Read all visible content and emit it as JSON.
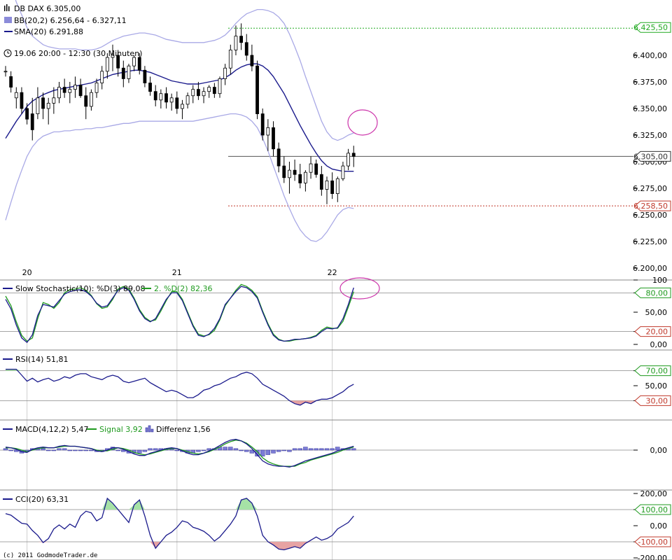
{
  "colors": {
    "navy": "#1a1a8c",
    "band": "#a9a9e6",
    "green": "#1f9a1f",
    "pinkFill": "#e7a3a3",
    "greenFill": "#a6e2a6",
    "histo": "#7c7cd6",
    "red": "#c0392b",
    "magenta": "#cc33aa",
    "grid": "#999999"
  },
  "legend": {
    "symbol": "DB DAX 6.305,00",
    "bb": "BB(20,2) 6.256,64 - 6.327,11",
    "sma": "SMA(20) 6.291,88",
    "time": "19.06 20:00 - 12:30 (30 Minuten)"
  },
  "price_badges": {
    "top": "6.425,50",
    "last": "6.305,00",
    "low": "6.258,50"
  },
  "x_labels": [
    "20",
    "21",
    "22"
  ],
  "copyright": "(c) 2011 GodmodeTrader.de",
  "panels": {
    "stoch": {
      "legend1": "Slow Stochastic(10): %D(3) 89,08",
      "legend2": "2. %D(2) 82,36",
      "ticks": [
        "100",
        "80,00",
        "50,00",
        "20,00",
        "0,00"
      ],
      "tickVals": [
        100,
        80,
        50,
        20,
        0
      ],
      "badges": [
        "80,00",
        "20,00"
      ]
    },
    "rsi": {
      "legend": "RSI(14) 51,81",
      "ticks": [
        "70,00",
        "50,00",
        "30,00"
      ],
      "tickVals": [
        70,
        50,
        30
      ],
      "badges": [
        "70,00",
        "30,00"
      ]
    },
    "macd": {
      "legend1": "MACD(4,12,2) 5,47",
      "legend2": "Signal 3,92",
      "legend3": "Differenz 1,56",
      "ticks": [
        "0,00"
      ],
      "tickVals": [
        0
      ]
    },
    "cci": {
      "legend": "CCI(20) 63,31",
      "ticks": [
        "200,00",
        "100,00",
        "0,00",
        "-100,00",
        "-200,00"
      ],
      "tickVals": [
        200,
        100,
        0,
        -100,
        -200
      ],
      "badges": [
        "100,00",
        "-100,00"
      ]
    }
  },
  "chart_data": {
    "type": "candlestick",
    "title": "DB DAX 6.305,00",
    "ylim": [
      6190,
      6430
    ],
    "y_ticks": [
      {
        "v": 6400,
        "t": "6.400,00"
      },
      {
        "v": 6375,
        "t": "6.375,00"
      },
      {
        "v": 6350,
        "t": "6.350,00"
      },
      {
        "v": 6325,
        "t": "6.325,00"
      },
      {
        "v": 6300,
        "t": "6.300,00"
      },
      {
        "v": 6275,
        "t": "6.275,00"
      },
      {
        "v": 6250,
        "t": "6.250,00"
      },
      {
        "v": 6225,
        "t": "6.225,00"
      },
      {
        "v": 6200,
        "t": "6.200,00"
      }
    ],
    "levels": {
      "top": 6425.5,
      "last": 6305,
      "low": 6258.5
    },
    "x_day_index": [
      4,
      32,
      61
    ],
    "candles": [
      [
        6385,
        6390,
        6380,
        6385
      ],
      [
        6380,
        6385,
        6365,
        6370
      ],
      [
        6360,
        6370,
        6350,
        6365
      ],
      [
        6365,
        6370,
        6345,
        6350
      ],
      [
        6350,
        6355,
        6335,
        6340
      ],
      [
        6345,
        6360,
        6320,
        6330
      ],
      [
        6345,
        6370,
        6340,
        6360
      ],
      [
        6360,
        6365,
        6340,
        6350
      ],
      [
        6350,
        6360,
        6335,
        6355
      ],
      [
        6355,
        6370,
        6345,
        6360
      ],
      [
        6360,
        6375,
        6355,
        6370
      ],
      [
        6370,
        6378,
        6360,
        6365
      ],
      [
        6365,
        6375,
        6355,
        6368
      ],
      [
        6368,
        6380,
        6360,
        6372
      ],
      [
        6372,
        6378,
        6360,
        6362
      ],
      [
        6362,
        6370,
        6340,
        6352
      ],
      [
        6352,
        6368,
        6348,
        6365
      ],
      [
        6365,
        6378,
        6360,
        6374
      ],
      [
        6374,
        6390,
        6368,
        6385
      ],
      [
        6385,
        6402,
        6378,
        6398
      ],
      [
        6398,
        6410,
        6385,
        6400
      ],
      [
        6400,
        6405,
        6380,
        6388
      ],
      [
        6388,
        6395,
        6370,
        6378
      ],
      [
        6378,
        6392,
        6374,
        6390
      ],
      [
        6390,
        6400,
        6385,
        6398
      ],
      [
        6398,
        6402,
        6382,
        6386
      ],
      [
        6386,
        6390,
        6370,
        6374
      ],
      [
        6374,
        6380,
        6362,
        6366
      ],
      [
        6366,
        6372,
        6352,
        6358
      ],
      [
        6358,
        6368,
        6350,
        6364
      ],
      [
        6364,
        6370,
        6350,
        6356
      ],
      [
        6356,
        6364,
        6348,
        6360
      ],
      [
        6360,
        6366,
        6345,
        6350
      ],
      [
        6350,
        6358,
        6340,
        6354
      ],
      [
        6354,
        6365,
        6350,
        6362
      ],
      [
        6362,
        6372,
        6355,
        6368
      ],
      [
        6368,
        6375,
        6358,
        6362
      ],
      [
        6362,
        6370,
        6355,
        6366
      ],
      [
        6366,
        6372,
        6360,
        6370
      ],
      [
        6370,
        6374,
        6360,
        6364
      ],
      [
        6364,
        6380,
        6360,
        6378
      ],
      [
        6378,
        6392,
        6372,
        6388
      ],
      [
        6388,
        6410,
        6382,
        6405
      ],
      [
        6405,
        6428,
        6400,
        6418
      ],
      [
        6418,
        6430,
        6405,
        6412
      ],
      [
        6412,
        6420,
        6395,
        6400
      ],
      [
        6400,
        6410,
        6385,
        6390
      ],
      [
        6390,
        6395,
        6340,
        6345
      ],
      [
        6345,
        6350,
        6320,
        6325
      ],
      [
        6325,
        6340,
        6310,
        6332
      ],
      [
        6332,
        6338,
        6305,
        6312
      ],
      [
        6312,
        6318,
        6290,
        6296
      ],
      [
        6296,
        6305,
        6280,
        6285
      ],
      [
        6285,
        6300,
        6270,
        6292
      ],
      [
        6292,
        6302,
        6282,
        6288
      ],
      [
        6288,
        6298,
        6275,
        6280
      ],
      [
        6280,
        6292,
        6272,
        6290
      ],
      [
        6290,
        6305,
        6284,
        6298
      ],
      [
        6298,
        6302,
        6285,
        6288
      ],
      [
        6288,
        6296,
        6268,
        6274
      ],
      [
        6274,
        6286,
        6260,
        6282
      ],
      [
        6282,
        6290,
        6265,
        6270
      ],
      [
        6270,
        6286,
        6262,
        6284
      ],
      [
        6284,
        6300,
        6282,
        6296
      ],
      [
        6296,
        6312,
        6292,
        6308
      ],
      [
        6308,
        6315,
        6295,
        6305
      ]
    ],
    "bb_upper": [
      6480,
      6465,
      6450,
      6438,
      6426,
      6418,
      6414,
      6410,
      6408,
      6407,
      6406,
      6406,
      6406,
      6406,
      6405,
      6405,
      6405,
      6406,
      6408,
      6411,
      6414,
      6416,
      6418,
      6419,
      6420,
      6421,
      6421,
      6420,
      6419,
      6417,
      6415,
      6414,
      6413,
      6412,
      6412,
      6412,
      6412,
      6412,
      6413,
      6414,
      6416,
      6419,
      6424,
      6430,
      6435,
      6439,
      6441,
      6443,
      6443,
      6442,
      6440,
      6436,
      6430,
      6420,
      6408,
      6395,
      6380,
      6366,
      6352,
      6338,
      6328,
      6322,
      6320,
      6322,
      6325,
      6327
    ],
    "bb_lower": [
      6245,
      6262,
      6278,
      6292,
      6305,
      6314,
      6320,
      6324,
      6326,
      6328,
      6328,
      6329,
      6329,
      6330,
      6330,
      6331,
      6331,
      6332,
      6332,
      6333,
      6334,
      6335,
      6336,
      6336,
      6337,
      6338,
      6338,
      6338,
      6338,
      6338,
      6338,
      6338,
      6338,
      6338,
      6338,
      6338,
      6339,
      6340,
      6341,
      6342,
      6343,
      6344,
      6345,
      6345,
      6344,
      6342,
      6338,
      6332,
      6322,
      6310,
      6296,
      6282,
      6268,
      6256,
      6245,
      6236,
      6230,
      6226,
      6225,
      6228,
      6234,
      6242,
      6250,
      6255,
      6257,
      6256
    ],
    "sma": [
      6322,
      6330,
      6338,
      6345,
      6352,
      6357,
      6360,
      6363,
      6365,
      6367,
      6368,
      6369,
      6370,
      6371,
      6372,
      6373,
      6374,
      6376,
      6378,
      6380,
      6382,
      6383,
      6384,
      6385,
      6386,
      6386,
      6385,
      6384,
      6382,
      6380,
      6378,
      6376,
      6375,
      6374,
      6373,
      6373,
      6373,
      6374,
      6375,
      6376,
      6377,
      6379,
      6382,
      6386,
      6389,
      6391,
      6392,
      6392,
      6390,
      6386,
      6380,
      6372,
      6364,
      6354,
      6344,
      6334,
      6325,
      6316,
      6308,
      6301,
      6296,
      6293,
      6292,
      6291,
      6291,
      6291
    ],
    "stoch_d": [
      70,
      55,
      30,
      10,
      3,
      15,
      45,
      62,
      60,
      58,
      68,
      78,
      82,
      84,
      85,
      82,
      75,
      64,
      58,
      60,
      72,
      84,
      88,
      84,
      70,
      52,
      40,
      35,
      40,
      55,
      70,
      80,
      80,
      68,
      48,
      28,
      14,
      12,
      16,
      25,
      40,
      62,
      72,
      82,
      90,
      88,
      82,
      72,
      50,
      30,
      14,
      7,
      5,
      6,
      8,
      8,
      9,
      10,
      13,
      20,
      25,
      24,
      26,
      40,
      62,
      88
    ],
    "stoch_d2": [
      75,
      60,
      35,
      14,
      5,
      10,
      40,
      65,
      62,
      56,
      65,
      80,
      85,
      86,
      88,
      84,
      76,
      63,
      56,
      58,
      70,
      86,
      90,
      86,
      72,
      54,
      42,
      36,
      38,
      52,
      68,
      82,
      82,
      70,
      50,
      30,
      16,
      13,
      15,
      22,
      38,
      60,
      72,
      84,
      93,
      90,
      84,
      74,
      52,
      32,
      16,
      8,
      5,
      5,
      7,
      8,
      9,
      11,
      14,
      22,
      27,
      25,
      25,
      36,
      58,
      82
    ],
    "rsi": [
      72,
      72,
      72,
      64,
      56,
      60,
      55,
      58,
      60,
      56,
      58,
      62,
      60,
      64,
      66,
      66,
      62,
      60,
      58,
      62,
      64,
      62,
      56,
      54,
      56,
      58,
      60,
      54,
      50,
      46,
      42,
      44,
      42,
      38,
      34,
      34,
      38,
      44,
      46,
      50,
      52,
      56,
      60,
      62,
      66,
      68,
      66,
      60,
      52,
      48,
      44,
      40,
      36,
      30,
      26,
      24,
      28,
      26,
      30,
      32,
      32,
      34,
      38,
      42,
      48,
      52
    ],
    "macd": [
      4,
      3,
      1,
      -2,
      -3,
      1,
      3,
      4,
      3,
      3,
      5,
      6,
      5,
      5,
      4,
      3,
      2,
      -1,
      -2,
      0,
      3,
      3,
      1,
      -2,
      -5,
      -7,
      -7,
      -4,
      -2,
      0,
      2,
      3,
      2,
      -1,
      -4,
      -6,
      -6,
      -4,
      -1,
      2,
      6,
      10,
      13,
      14,
      12,
      8,
      2,
      -6,
      -14,
      -18,
      -20,
      -21,
      -21,
      -22,
      -20,
      -17,
      -14,
      -12,
      -10,
      -8,
      -6,
      -4,
      -1,
      1,
      3,
      5
    ],
    "signal": [
      3,
      3,
      2,
      0,
      -2,
      0,
      2,
      3,
      3,
      3,
      4,
      5,
      5,
      5,
      4,
      3,
      2,
      0,
      -1,
      -1,
      1,
      3,
      2,
      0,
      -3,
      -5,
      -6,
      -5,
      -3,
      -1,
      1,
      2,
      2,
      0,
      -2,
      -4,
      -5,
      -4,
      -2,
      1,
      4,
      8,
      11,
      13,
      12,
      9,
      4,
      -2,
      -10,
      -15,
      -18,
      -20,
      -21,
      -21,
      -21,
      -18,
      -16,
      -13,
      -11,
      -9,
      -7,
      -5,
      -3,
      0,
      2,
      4
    ],
    "cci": [
      75,
      65,
      40,
      15,
      10,
      -30,
      -60,
      -105,
      -80,
      -20,
      5,
      -20,
      10,
      -10,
      60,
      90,
      80,
      30,
      50,
      170,
      140,
      100,
      60,
      20,
      130,
      160,
      60,
      -60,
      -140,
      -100,
      -60,
      -40,
      -10,
      30,
      20,
      -10,
      -20,
      -35,
      -60,
      -95,
      -70,
      -30,
      10,
      60,
      160,
      170,
      140,
      60,
      -60,
      -100,
      -120,
      -145,
      -150,
      -140,
      -130,
      -140,
      -110,
      -90,
      -70,
      -90,
      -80,
      -60,
      -20,
      0,
      20,
      60
    ]
  }
}
